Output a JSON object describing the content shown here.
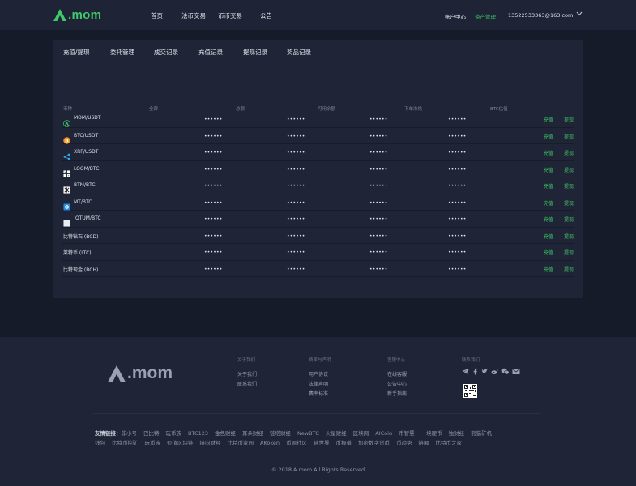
{
  "brand": {
    "name": ".mom",
    "accent": "#3fc96a"
  },
  "nav": {
    "items": [
      "首页",
      "法币交易",
      "币币交易",
      "公告"
    ],
    "account_center": "账户中心",
    "asset_management": "资产管理",
    "user_email": "13522533363@163.com"
  },
  "tabs": [
    "充值/提现",
    "委托管理",
    "成交记录",
    "充值记录",
    "提现记录",
    "奖品记录"
  ],
  "table": {
    "headers": [
      "币种",
      "全部",
      "总额",
      "可用余额",
      "下单冻结",
      "BTC估值"
    ],
    "deposit_label": "充值",
    "withdraw_label": "提现",
    "mask": "••••••",
    "rows": [
      {
        "name": "MOM/USDT",
        "icon": "mom-icon"
      },
      {
        "name": "BTC/USDT",
        "icon": "btc-icon"
      },
      {
        "name": "XRP/USDT",
        "icon": "xrp-icon"
      },
      {
        "name": "LOOM/BTC",
        "icon": "loom-icon"
      },
      {
        "name": "BTM/BTC",
        "icon": "btm-icon"
      },
      {
        "name": "MT/BTC",
        "icon": "mt-icon"
      },
      {
        "name": "QTUM/BTC",
        "icon": "qtum-icon"
      },
      {
        "name": "比特钻石 (BCD)",
        "icon": ""
      },
      {
        "name": "莱特币 (LTC)",
        "icon": ""
      },
      {
        "name": "比特现金 (BCH)",
        "icon": ""
      }
    ]
  },
  "footer": {
    "columns": [
      {
        "title": "关于我们",
        "links": [
          "关于我们",
          "联系我们"
        ]
      },
      {
        "title": "费率与声明",
        "links": [
          "用户协议",
          "法律声明",
          "费率标准"
        ]
      },
      {
        "title": "客服中心",
        "links": [
          "在线客服",
          "公告中心",
          "新手指南"
        ]
      },
      {
        "title": "联系我们",
        "links": []
      }
    ],
    "friend_links_label": "友情链接：",
    "friend_links_row1": [
      "非小号",
      "巴比特",
      "玩币族",
      "BTC123",
      "金色财经",
      "耳朵财经",
      "链塔财经",
      "NewBTC",
      "火星财经",
      "区块网",
      "AICoin",
      "币智慧",
      "一块硬币",
      "独财经",
      "熊猫矿机"
    ],
    "friend_links_row2": [
      "钱包",
      "比特币挖矿",
      "玩币族",
      "价值区块链",
      "链向财经",
      "比特币家园",
      "AKoken",
      "币源社区",
      "链世界",
      "币报道",
      "加密数字货币",
      "币趋势",
      "链闻",
      "比特币之家"
    ],
    "copyright": "© 2018 A.mom All Rights Reserved"
  }
}
